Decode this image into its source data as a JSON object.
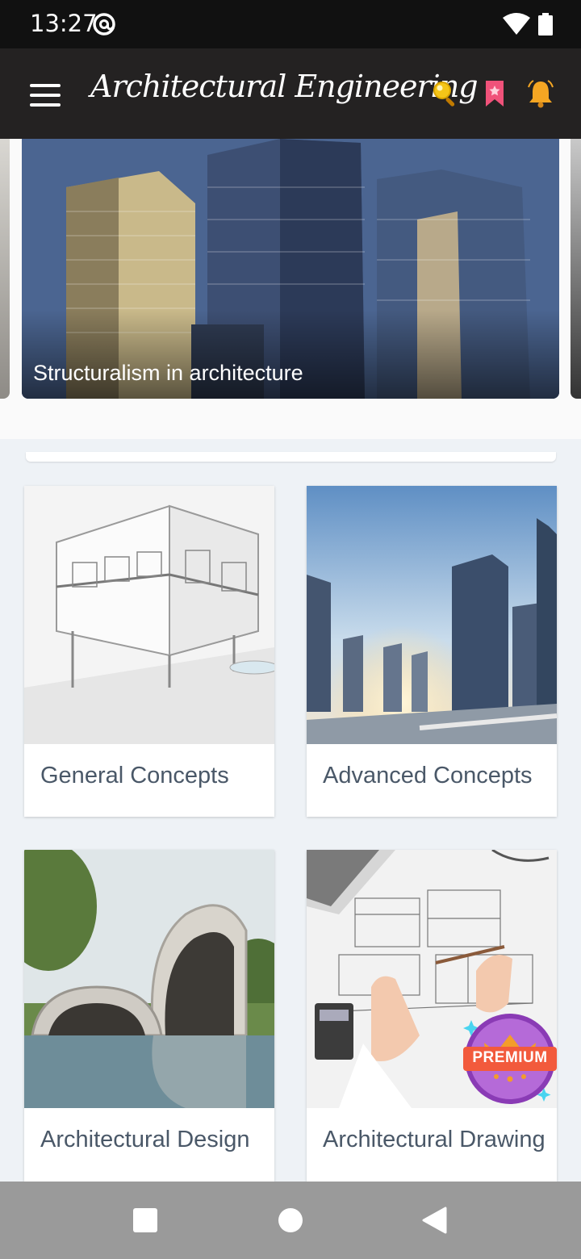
{
  "status_bar": {
    "time": "13:27",
    "icons": [
      "at-sign-icon",
      "wifi-icon",
      "battery-icon"
    ]
  },
  "app_bar": {
    "title": "Architectural Engineering",
    "icons": [
      "menu-icon",
      "search-icon",
      "bookmark-icon",
      "bell-icon"
    ],
    "accent_colors": {
      "search": "#f5c518",
      "bookmark": "#f0527a",
      "bell": "#f5a623"
    }
  },
  "carousel": {
    "current_caption": "Structuralism in architecture"
  },
  "cards": [
    {
      "label": "General Concepts"
    },
    {
      "label": "Advanced Concepts"
    },
    {
      "label": "Architectural Design"
    },
    {
      "label": "Architectural Drawing"
    }
  ],
  "premium_badge": {
    "label": "PREMIUM"
  },
  "nav_bar": {
    "icons": [
      "recents-square-icon",
      "home-circle-icon",
      "back-triangle-icon"
    ]
  }
}
